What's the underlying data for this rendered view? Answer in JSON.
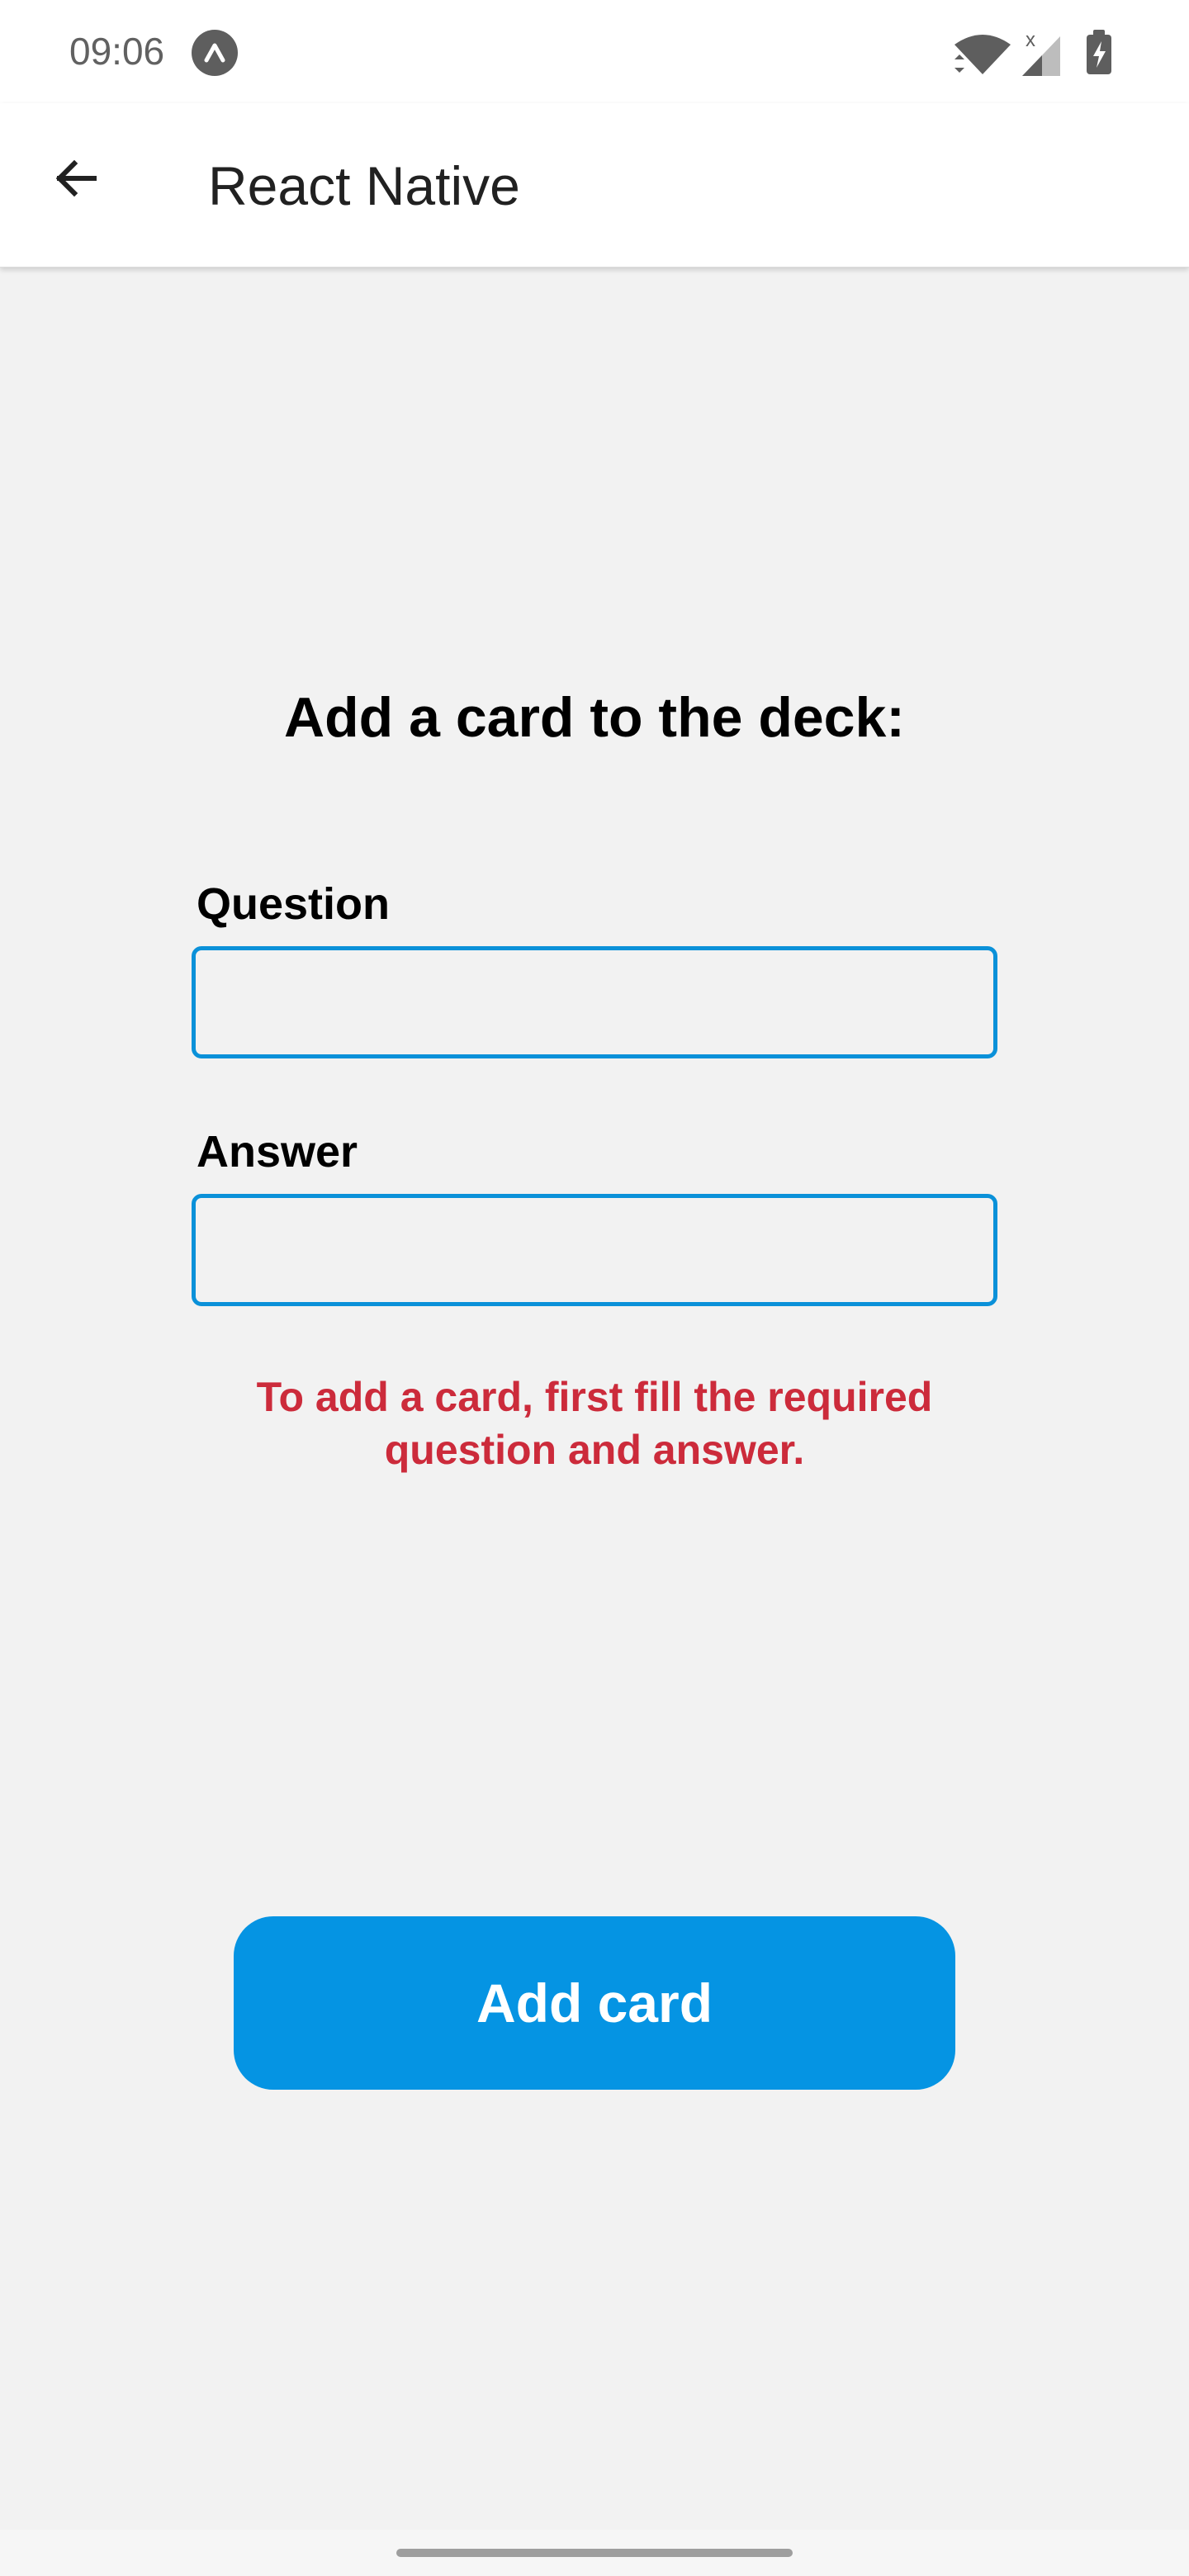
{
  "status_bar": {
    "time": "09:06"
  },
  "app_bar": {
    "title": "React Native"
  },
  "form": {
    "heading": "Add a card to the deck:",
    "question_label": "Question",
    "question_value": "",
    "answer_label": "Answer",
    "answer_value": "",
    "error_message": "To add a card, first fill the required question and answer.",
    "submit_label": "Add card"
  },
  "colors": {
    "accent": "#0594e3",
    "input_border": "#0b91d9",
    "error": "#cc2b3b",
    "background": "#f2f2f2"
  },
  "icons": {
    "back": "arrow-back-icon",
    "expo": "expo-app-icon",
    "wifi": "wifi-icon",
    "signal": "cell-signal-icon",
    "battery": "battery-charging-icon"
  }
}
